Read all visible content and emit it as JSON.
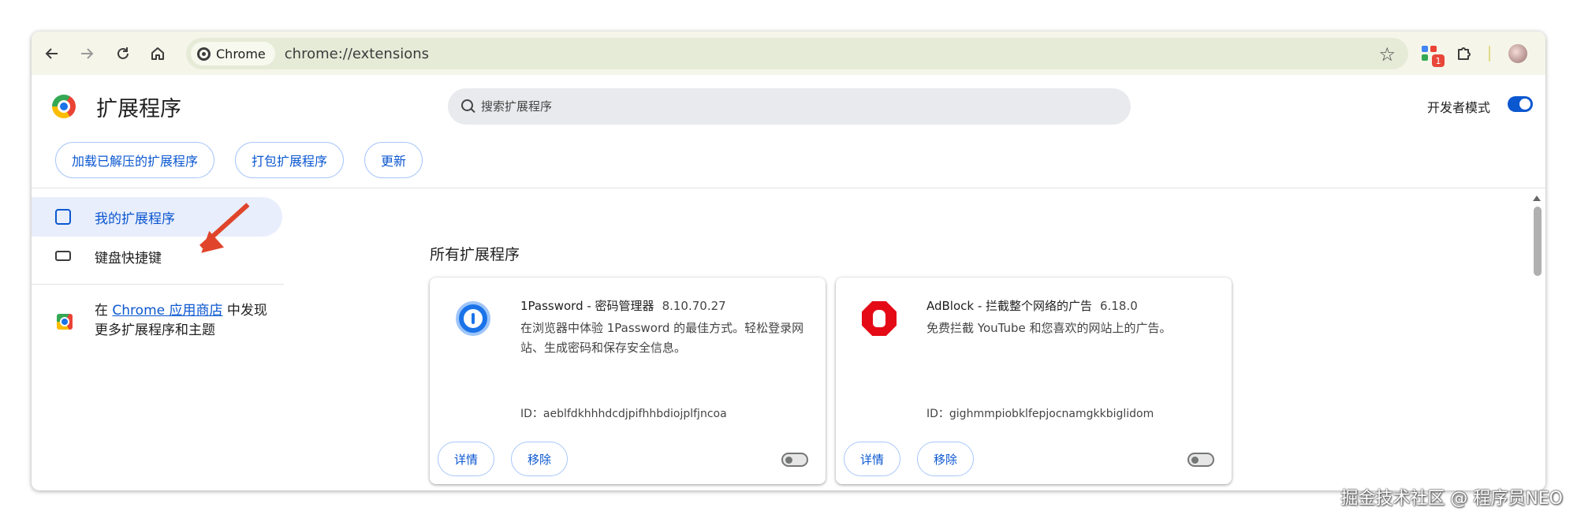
{
  "toolbar": {
    "back_icon": "arrow-left-icon",
    "forward_icon": "arrow-right-icon",
    "reload_icon": "reload-icon",
    "home_icon": "home-icon",
    "chip_label": "Chrome",
    "url": "chrome://extensions",
    "extension_badge": "1",
    "bookmark_icon": "star-icon"
  },
  "header": {
    "title": "扩展程序",
    "search_placeholder": "搜索扩展程序",
    "dev_mode_label": "开发者模式",
    "dev_mode_on": true
  },
  "actions": {
    "load_unpacked": "加载已解压的扩展程序",
    "pack": "打包扩展程序",
    "update": "更新"
  },
  "sidebar": {
    "items": [
      {
        "label": "我的扩展程序",
        "icon": "puzzle-icon",
        "active": true
      },
      {
        "label": "键盘快捷键",
        "icon": "keyboard-icon",
        "active": false
      }
    ],
    "store_prefix": "在 ",
    "store_link": "Chrome 应用商店",
    "store_suffix": " 中发现更多扩展程序和主题"
  },
  "main": {
    "section_title": "所有扩展程序",
    "extensions": [
      {
        "name": "1Password - 密码管理器",
        "version": "8.10.70.27",
        "description": "在浏览器中体验 1Password 的最佳方式。轻松登录网站、生成密码和保存安全信息。",
        "id": "ID：aeblfdkhhhdcdjpifhhbdiojplfjncoa",
        "details": "详情",
        "remove": "移除",
        "enabled": false
      },
      {
        "name": "AdBlock - 拦截整个网络的广告",
        "version": "6.18.0",
        "description": "免费拦截 YouTube 和您喜欢的网站上的广告。",
        "id": "ID：gighmmpiobklfepjocnamgkkbiglidom",
        "details": "详情",
        "remove": "移除",
        "enabled": false
      }
    ]
  },
  "watermark": "掘金技术社区 @ 程序员NEO",
  "colors": {
    "accent": "#0b57d0",
    "toolbar_bg": "#f5f6e9",
    "annotation_arrow": "#e0452b"
  }
}
